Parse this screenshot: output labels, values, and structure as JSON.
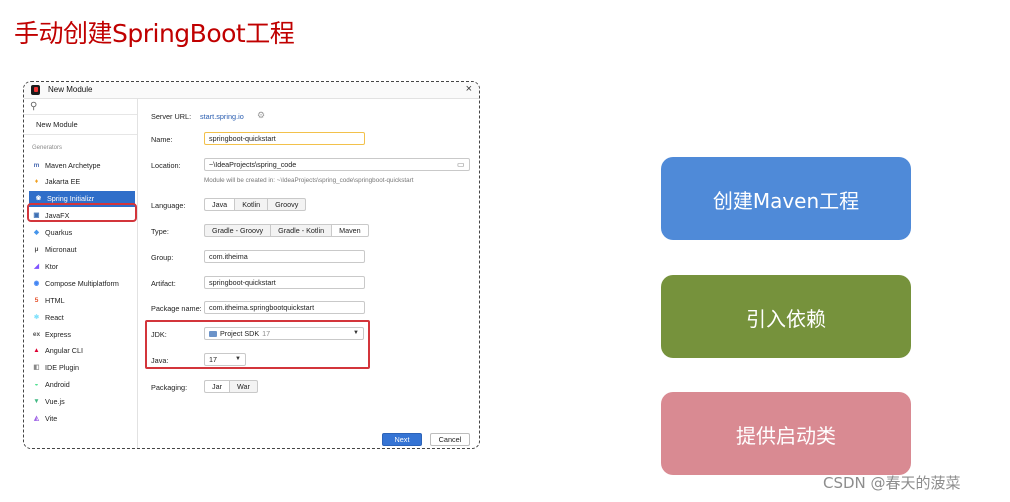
{
  "slide": {
    "title": "手动创建SpringBoot工程"
  },
  "dialog": {
    "title": "New Module",
    "close_glyph": "×",
    "search_glyph": "⚲",
    "new_module_label": "New Module",
    "generators_heading": "Generators",
    "generators": [
      {
        "label": "Maven Archetype",
        "icon": "maven-icon",
        "glyph": "m",
        "color": "#4d6db3",
        "selected": false
      },
      {
        "label": "Jakarta EE",
        "icon": "jakarta-icon",
        "glyph": "♦",
        "color": "#f0a020",
        "selected": false
      },
      {
        "label": "Spring Initializr",
        "icon": "spring-icon",
        "glyph": "❀",
        "color": "#6db33f",
        "selected": true
      },
      {
        "label": "JavaFX",
        "icon": "javafx-icon",
        "glyph": "▣",
        "color": "#3d6fb4",
        "selected": false
      },
      {
        "label": "Quarkus",
        "icon": "quarkus-icon",
        "glyph": "◆",
        "color": "#4695eb",
        "selected": false
      },
      {
        "label": "Micronaut",
        "icon": "micronaut-icon",
        "glyph": "μ",
        "color": "#555555",
        "selected": false
      },
      {
        "label": "Ktor",
        "icon": "ktor-icon",
        "glyph": "◢",
        "color": "#7f52ff",
        "selected": false
      },
      {
        "label": "Compose Multiplatform",
        "icon": "compose-icon",
        "glyph": "◉",
        "color": "#4285f4",
        "selected": false
      },
      {
        "label": "HTML",
        "icon": "html-icon",
        "glyph": "5",
        "color": "#e44d26",
        "selected": false
      },
      {
        "label": "React",
        "icon": "react-icon",
        "glyph": "⚛",
        "color": "#61dafb",
        "selected": false
      },
      {
        "label": "Express",
        "icon": "express-icon",
        "glyph": "ex",
        "color": "#555555",
        "selected": false
      },
      {
        "label": "Angular CLI",
        "icon": "angular-icon",
        "glyph": "▲",
        "color": "#dd0031",
        "selected": false
      },
      {
        "label": "IDE Plugin",
        "icon": "plugin-icon",
        "glyph": "◧",
        "color": "#888888",
        "selected": false
      },
      {
        "label": "Android",
        "icon": "android-icon",
        "glyph": "◒",
        "color": "#3ddc84",
        "selected": false
      },
      {
        "label": "Vue.js",
        "icon": "vue-icon",
        "glyph": "▼",
        "color": "#42b883",
        "selected": false
      },
      {
        "label": "Vite",
        "icon": "vite-icon",
        "glyph": "◭",
        "color": "#9b5de5",
        "selected": false
      }
    ],
    "help_glyph": "?",
    "form": {
      "server_url_label": "Server URL:",
      "server_url_value": "start.spring.io",
      "gear_glyph": "⚙",
      "name_label": "Name:",
      "name_value": "springboot-quickstart",
      "location_label": "Location:",
      "location_value": "~\\IdeaProjects\\spring_code",
      "folder_glyph": "▭",
      "location_hint": "Module will be created in: ~\\IdeaProjects\\spring_code\\springboot-quickstart",
      "language_label": "Language:",
      "languages": [
        "Java",
        "Kotlin",
        "Groovy"
      ],
      "language_selected": "Java",
      "type_label": "Type:",
      "types": [
        "Gradle - Groovy",
        "Gradle - Kotlin",
        "Maven"
      ],
      "type_selected": "Maven",
      "group_label": "Group:",
      "group_value": "com.itheima",
      "artifact_label": "Artifact:",
      "artifact_value": "springboot-quickstart",
      "package_label": "Package name:",
      "package_value": "com.itheima.springbootquickstart",
      "jdk_label": "JDK:",
      "jdk_value": "Project SDK",
      "jdk_version": "17",
      "java_label": "Java:",
      "java_value": "17",
      "packaging_label": "Packaging:",
      "packagings": [
        "Jar",
        "War"
      ],
      "packaging_selected": "Jar",
      "arrow_glyph": "▼"
    },
    "buttons": {
      "next": "Next",
      "cancel": "Cancel"
    }
  },
  "steps": [
    {
      "label": "创建Maven工程",
      "color": "#4f8ad8"
    },
    {
      "label": "引入依赖",
      "color": "#76923c"
    },
    {
      "label": "提供启动类",
      "color": "#d98a92"
    }
  ],
  "watermark": "CSDN @春天的菠菜"
}
